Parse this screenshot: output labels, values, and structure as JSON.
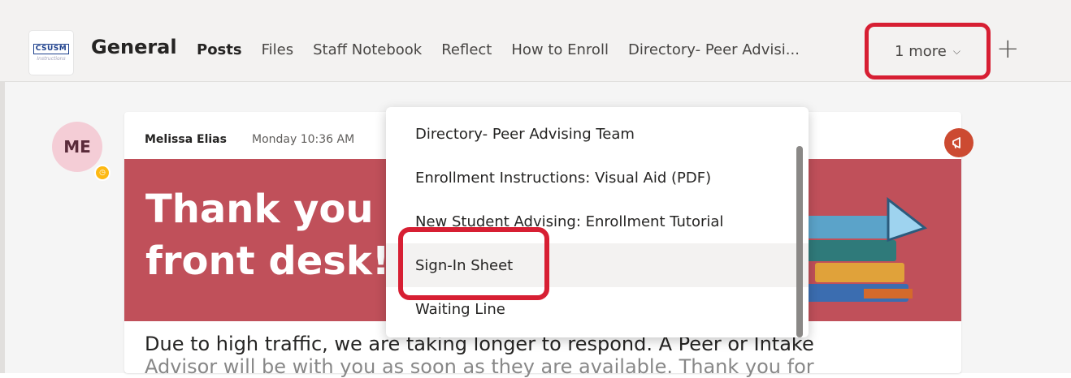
{
  "team": {
    "logo_line1": "CSUSM",
    "logo_line2": "Instructions"
  },
  "channel": {
    "title": "General"
  },
  "tabs": [
    {
      "label": "Posts"
    },
    {
      "label": "Files"
    },
    {
      "label": "Staff Notebook"
    },
    {
      "label": "Reflect"
    },
    {
      "label": "How to Enroll"
    },
    {
      "label": "Directory- Peer Advisi..."
    }
  ],
  "more_tab": {
    "label": "1 more",
    "chevron": "chevron-down-icon"
  },
  "add_tab": {
    "icon": "plus-icon",
    "glyph": "+"
  },
  "post": {
    "avatar_initials": "ME",
    "author": "Melissa Elias",
    "timestamp": "Monday 10:36 AM",
    "banner_line1": "Thank you for visiting the",
    "banner_line2": "front desk!",
    "body_line1": "Due to high traffic, we are taking longer to respond. A Peer or Intake",
    "body_line2": "Advisor will be with you as soon as they are available. Thank you for"
  },
  "dropdown": {
    "items": [
      {
        "label": "Directory- Peer Advising Team"
      },
      {
        "label": "Enrollment Instructions: Visual Aid (PDF)"
      },
      {
        "label": "New Student Advising: Enrollment Tutorial"
      },
      {
        "label": "Sign-In Sheet"
      },
      {
        "label": "Waiting Line"
      }
    ]
  },
  "colors": {
    "accent": "#6264a7",
    "highlight": "#d71f33",
    "banner": "#c0505a",
    "announce": "#cc4a31"
  }
}
